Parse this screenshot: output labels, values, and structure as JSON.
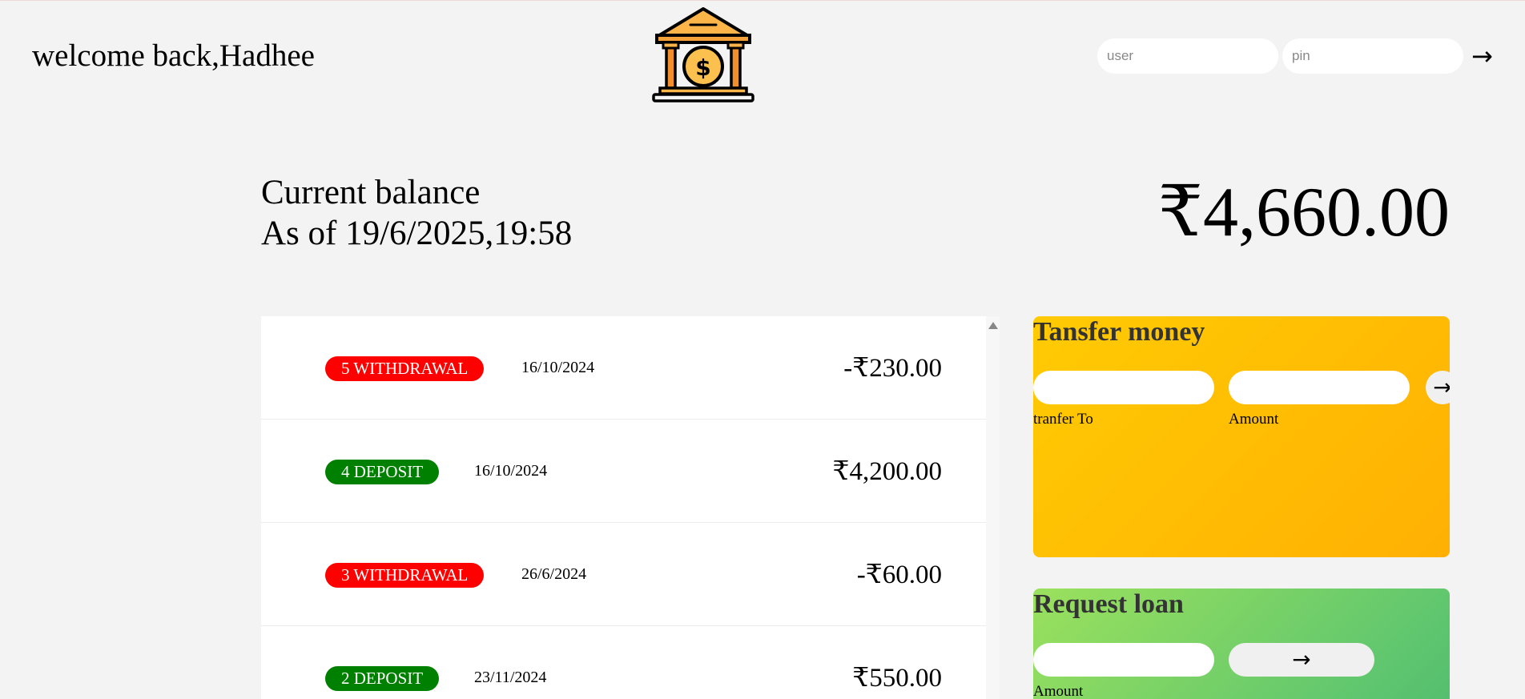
{
  "header": {
    "welcome": "welcome back,Hadhee",
    "login": {
      "user_placeholder": "user",
      "pin_placeholder": "pin",
      "submit_label": "→"
    }
  },
  "balance": {
    "label": "Current balance",
    "as_of": "As of 19/6/2025,19:58",
    "value": "₹4,660.00"
  },
  "movements": [
    {
      "type": "withdrawal",
      "label": "5 WITHDRAWAL",
      "date": "16/10/2024",
      "amount": "-₹230.00"
    },
    {
      "type": "deposit",
      "label": "4 DEPOSIT",
      "date": "16/10/2024",
      "amount": "₹4,200.00"
    },
    {
      "type": "withdrawal",
      "label": "3 WITHDRAWAL",
      "date": "26/6/2024",
      "amount": "-₹60.00"
    },
    {
      "type": "deposit",
      "label": "2 DEPOSIT",
      "date": "23/11/2024",
      "amount": "₹550.00"
    }
  ],
  "transfer": {
    "title": "Tansfer money",
    "to_label": "tranfer To",
    "amount_label": "Amount",
    "submit_label": "→"
  },
  "loan": {
    "title": "Request loan",
    "amount_label": "Amount",
    "submit_label": "→"
  },
  "colors": {
    "withdrawal": "#ff0000",
    "deposit": "#008000",
    "transfer_bg": "#ffb903",
    "loan_bg": "#7fd865",
    "background": "#f3f3f3"
  },
  "icons": {
    "logo": "bank-dollar-icon"
  }
}
